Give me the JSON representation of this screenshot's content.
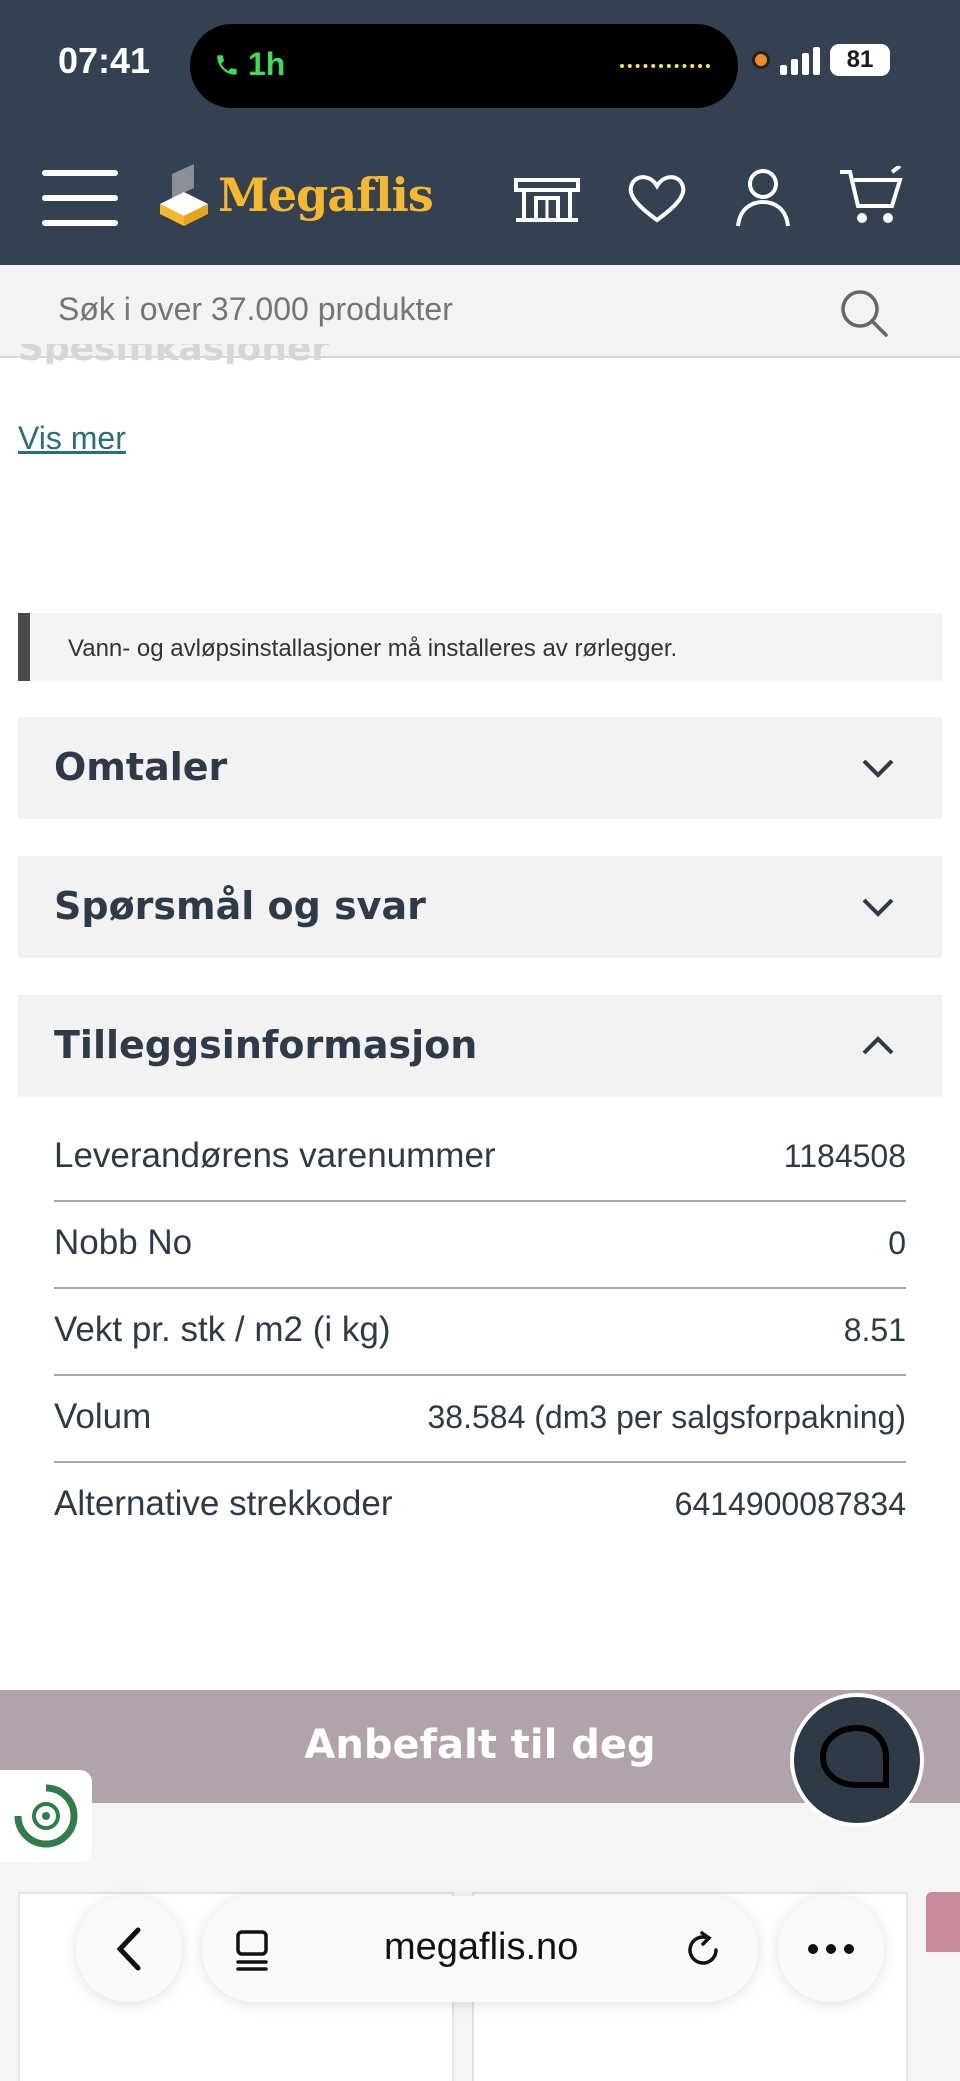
{
  "status_bar": {
    "time": "07:41",
    "call_duration": "1h",
    "battery": "81"
  },
  "header": {
    "brand": "Megaflis"
  },
  "search": {
    "placeholder": "Søk i over 37.000 produkter"
  },
  "specs": {
    "heading_faded": "Spesifikasjoner",
    "show_more": "Vis mer"
  },
  "notice": {
    "text": "Vann- og avløpsinstallasjoner må installeres av rørlegger."
  },
  "accordions": [
    {
      "title": "Omtaler",
      "state": "collapsed"
    },
    {
      "title": "Spørsmål og svar",
      "state": "collapsed"
    },
    {
      "title": "Tilleggsinformasjon",
      "state": "expanded"
    }
  ],
  "additional_info": [
    {
      "label": "Leverandørens varenummer",
      "value": "1184508"
    },
    {
      "label": "Nobb No",
      "value": "0"
    },
    {
      "label": "Vekt pr. stk / m2 (i kg)",
      "value": "8.51"
    },
    {
      "label": "Volum",
      "value": "38.584 (dm3 per salgsforpakning)"
    },
    {
      "label": "Alternative strekkoder",
      "value": "6414900087834"
    }
  ],
  "recommended": {
    "title": "Anbefalt til deg"
  },
  "browser": {
    "url": "megaflis.no"
  },
  "colors": {
    "header_bg": "#344150",
    "brand_yellow": "#f5b82e",
    "link_teal": "#2a6f77",
    "reco_bg": "#b1a3ab"
  }
}
